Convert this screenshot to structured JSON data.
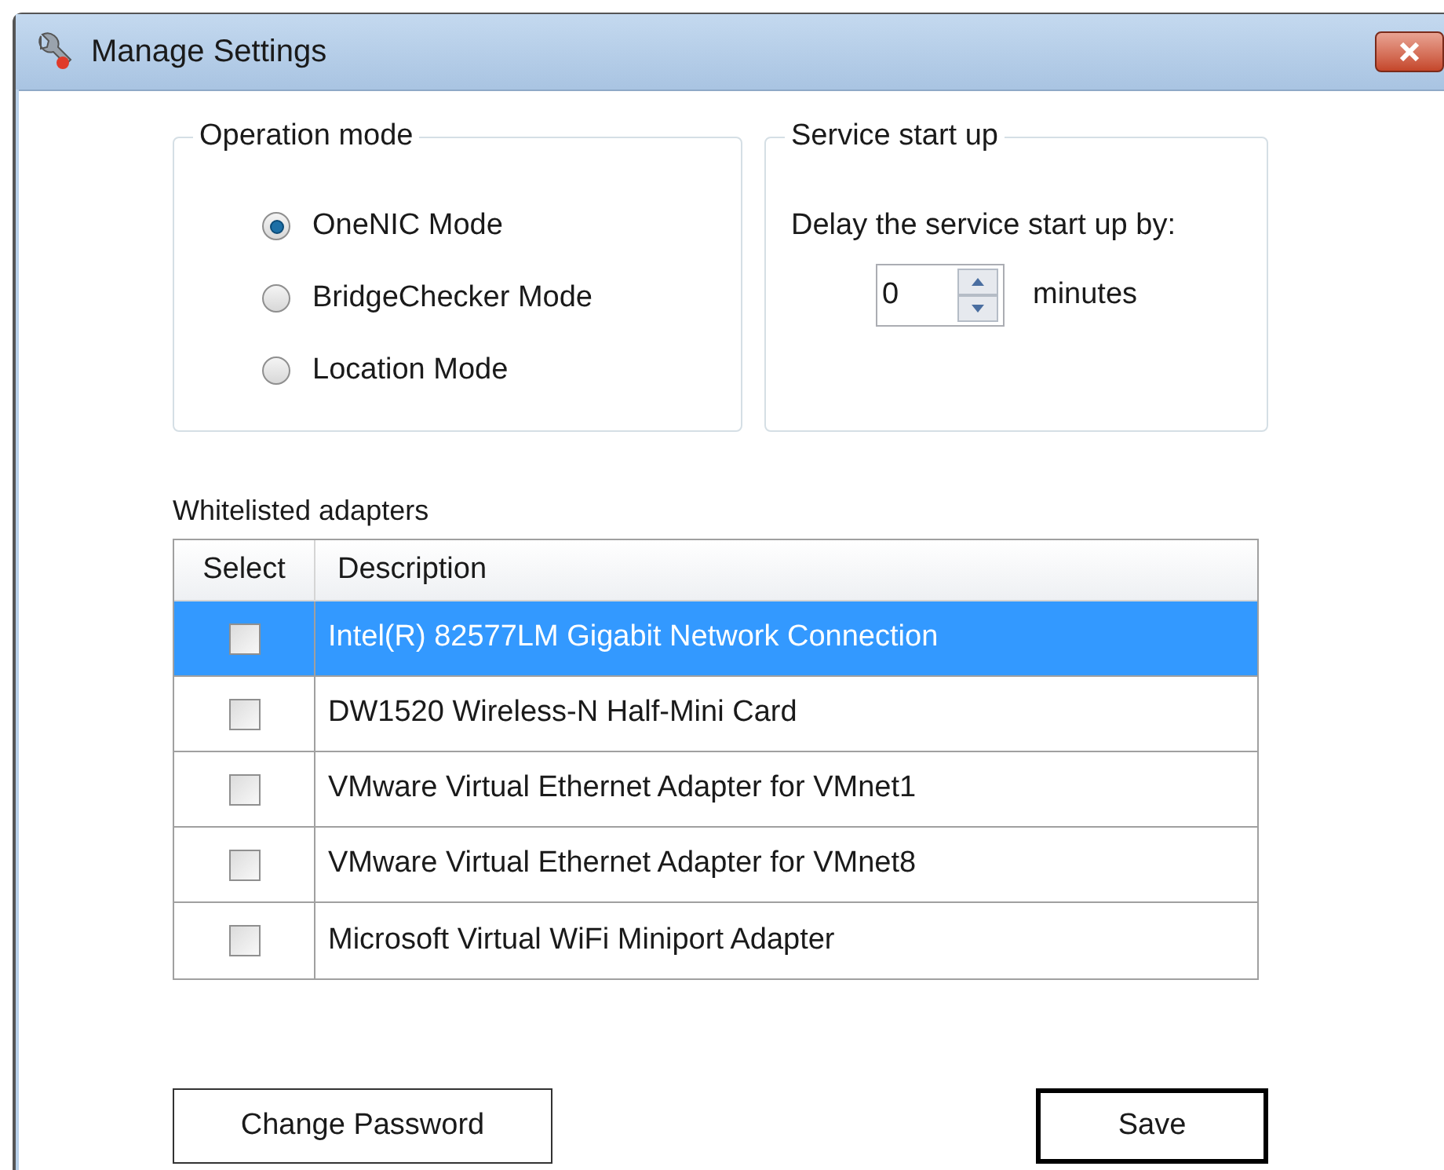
{
  "window": {
    "title": "Manage Settings"
  },
  "operation_mode": {
    "title": "Operation mode",
    "options": [
      {
        "label": "OneNIC Mode",
        "selected": true
      },
      {
        "label": "BridgeChecker Mode",
        "selected": false
      },
      {
        "label": "Location Mode",
        "selected": false
      }
    ]
  },
  "service_start_up": {
    "title": "Service start up",
    "label": "Delay the service start up by:",
    "value": "0",
    "unit": "minutes"
  },
  "whitelisted_adapters": {
    "title": "Whitelisted adapters",
    "columns": [
      "Select",
      "Description"
    ],
    "rows": [
      {
        "checked": false,
        "selected": true,
        "description": "Intel(R) 82577LM Gigabit Network Connection"
      },
      {
        "checked": false,
        "selected": false,
        "description": "DW1520 Wireless-N Half-Mini Card"
      },
      {
        "checked": false,
        "selected": false,
        "description": "VMware Virtual Ethernet Adapter for VMnet1"
      },
      {
        "checked": false,
        "selected": false,
        "description": "VMware Virtual Ethernet Adapter for VMnet8"
      },
      {
        "checked": false,
        "selected": false,
        "description": "Microsoft Virtual WiFi Miniport Adapter"
      }
    ]
  },
  "buttons": [
    {
      "label": "Change Password",
      "default": false
    },
    {
      "label": "Save",
      "default": true
    }
  ]
}
